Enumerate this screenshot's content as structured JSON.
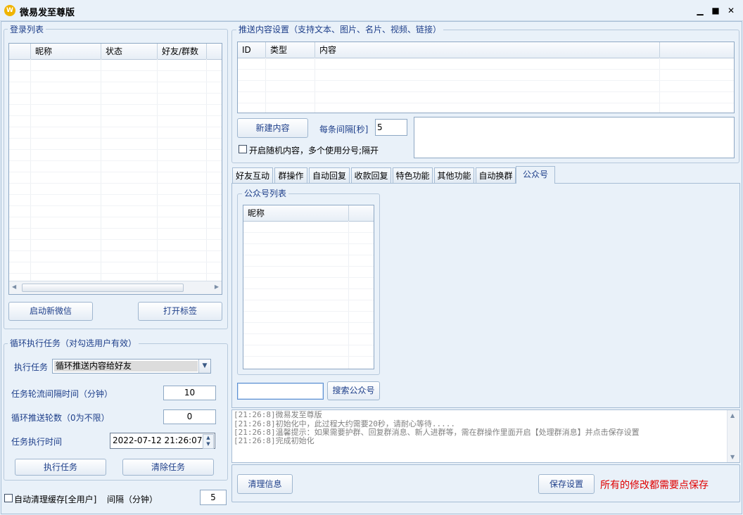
{
  "app": {
    "title": "微易发至尊版",
    "icon": "W"
  },
  "window_controls": {
    "minimize": "▁",
    "maximize": "■",
    "close": "✕"
  },
  "login_list": {
    "legend": "登录列表",
    "columns": [
      "",
      "昵称",
      "状态",
      "好友/群数"
    ],
    "start_button": "启动新微信",
    "open_tags_button": "打开标签"
  },
  "loop_task": {
    "legend": "循环执行任务（对勾选用户有效）",
    "task_label": "执行任务",
    "task_value": "循环推送内容给好友",
    "interval_label": "任务轮流间隔时间（分钟）",
    "interval_value": "10",
    "rounds_label": "循环推送轮数（0为不限）",
    "rounds_value": "0",
    "time_label": "任务执行时间",
    "time_value": "2022-07-12 21:26:07",
    "run_button": "执行任务",
    "clear_button": "清除任务"
  },
  "auto_clean": {
    "checkbox_label": "自动清理缓存[全用户]",
    "interval_label": "间隔（分钟）",
    "interval_value": "5"
  },
  "push_settings": {
    "legend": "推送内容设置（支持文本、图片、名片、视频、链接）",
    "columns": [
      "ID",
      "类型",
      "内容",
      ""
    ],
    "new_button": "新建内容",
    "interval_label": "每条间隔[秒]",
    "interval_value": "5",
    "random_label": "开启随机内容，多个使用分号;隔开"
  },
  "tabs": [
    "好友互动",
    "群操作",
    "自动回复",
    "收款回复",
    "特色功能",
    "其他功能",
    "自动换群",
    "公众号"
  ],
  "active_tab": "公众号",
  "official_accounts": {
    "legend": "公众号列表",
    "columns": [
      "昵称",
      ""
    ],
    "search_value": "",
    "search_button": "搜索公众号"
  },
  "log": [
    "[21:26:8]微易发至尊版",
    "[21:26:8]初始化中，此过程大约需要20秒，请耐心等待.....",
    "[21:26:8]温馨提示：如果需要护群、回复群消息、新人进群等，需在群操作里面开启【处理群消息】并点击保存设置",
    "[21:26:8]完成初始化"
  ],
  "footer": {
    "clear_info_button": "清理信息",
    "save_button": "保存设置",
    "save_notice": "所有的修改都需要点保存",
    "notice_color": "#e00000"
  }
}
